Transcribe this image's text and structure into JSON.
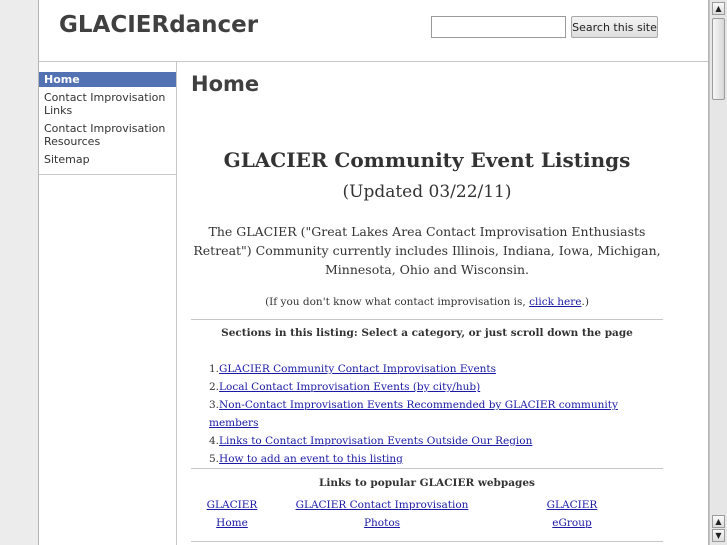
{
  "header": {
    "site_title": "GLACIERdancer",
    "search_placeholder": "",
    "search_button": "Search this site"
  },
  "sidebar": {
    "items": [
      {
        "label": "Home",
        "active": true
      },
      {
        "label": "Contact Improvisation Links",
        "active": false
      },
      {
        "label": "Contact Improvisation Resources",
        "active": false
      },
      {
        "label": "Sitemap",
        "active": false
      }
    ]
  },
  "main": {
    "page_heading": "Home",
    "title": "GLACIER Community Event Listings",
    "updated": "(Updated 03/22/11)",
    "intro": "The GLACIER (\"Great Lakes Area Contact Improvisation Enthusiasts Retreat\") Community currently includes Illinois, Indiana, Iowa, Michigan, Minnesota, Ohio and Wisconsin.",
    "ci_note_prefix": "(If you don't know what contact improvisation is, ",
    "ci_note_link": "click here",
    "ci_note_suffix": ".)",
    "sections_heading": "Sections in this listing: Select a category, or just scroll down the page",
    "sections": [
      {
        "num": "1.",
        "label": "GLACIER Community Contact Improvisation Events"
      },
      {
        "num": "2.",
        "label": "Local Contact Improvisation Events (by city/hub)"
      },
      {
        "num": "3.",
        "label": "Non-Contact Improvisation Events Recommended by GLACIER community members"
      },
      {
        "num": "4.",
        "label": "Links to Contact Improvisation Events Outside Our Region"
      },
      {
        "num": "5.",
        "label": "How to add an event to this listing"
      }
    ],
    "popular_heading": "Links to popular GLACIER webpages",
    "popular_links": [
      {
        "line1": "GLACIER",
        "line2": "Home"
      },
      {
        "line1": "GLACIER Contact Improvisation Photos",
        "line2": ""
      },
      {
        "line1": "GLACIER",
        "line2": "eGroup"
      }
    ]
  },
  "colors": {
    "nav_active_bg": "#5272b4",
    "link": "#1a1aa6",
    "heading": "#404040"
  }
}
